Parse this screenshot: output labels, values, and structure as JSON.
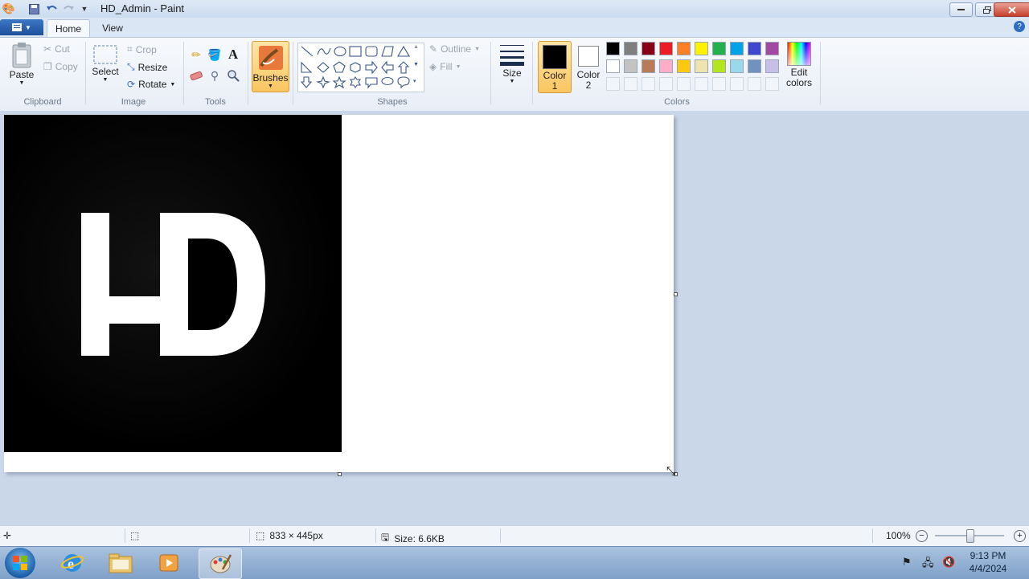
{
  "window": {
    "title": "HD_Admin - Paint"
  },
  "tabs": [
    {
      "label": "Home"
    },
    {
      "label": "View"
    }
  ],
  "clipboard": {
    "group": "Clipboard",
    "paste": "Paste",
    "cut": "Cut",
    "copy": "Copy"
  },
  "image": {
    "group": "Image",
    "select": "Select",
    "crop": "Crop",
    "resize": "Resize",
    "rotate": "Rotate"
  },
  "tools": {
    "group": "Tools"
  },
  "brushes": {
    "label": "Brushes"
  },
  "shapes": {
    "group": "Shapes",
    "outline": "Outline",
    "fill": "Fill"
  },
  "size": {
    "label": "Size"
  },
  "colors": {
    "group": "Colors",
    "color1": "Color\n1",
    "color1_a": "Color",
    "color1_b": "1",
    "color2_a": "Color",
    "color2_b": "2",
    "edit_a": "Edit",
    "edit_b": "colors",
    "color1_value": "#000000",
    "color2_value": "#ffffff",
    "palette_row1": [
      "#000000",
      "#7f7f7f",
      "#880015",
      "#ed1c24",
      "#ff7f27",
      "#fff200",
      "#22b14c",
      "#00a2e8",
      "#3f48cc",
      "#a349a4"
    ],
    "palette_row2": [
      "#ffffff",
      "#c3c3c3",
      "#b97a57",
      "#ffaec9",
      "#ffc90e",
      "#efe4b0",
      "#b5e61d",
      "#99d9ea",
      "#7092be",
      "#c8bfe7"
    ]
  },
  "canvas": {
    "image_text": "HD"
  },
  "status": {
    "dimensions": "833 × 445px",
    "size": "Size: 6.6KB",
    "zoom": "100%"
  },
  "taskbar": {
    "time": "9:13 PM",
    "date": "4/4/2024"
  }
}
